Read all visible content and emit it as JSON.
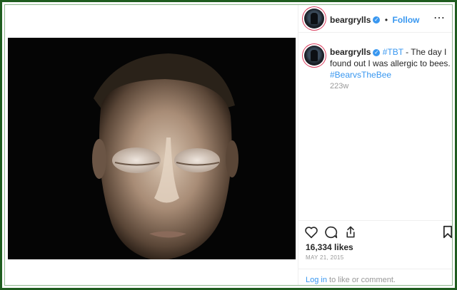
{
  "header": {
    "username": "beargrylls",
    "separator": "•",
    "follow_label": "Follow",
    "more_label": "⋯"
  },
  "post": {
    "username": "beargrylls",
    "hashtag_tbt": "#TBT",
    "caption_text": " - The day I found out I was allergic to bees.",
    "hashtag_bee": "#BearvsTheBee",
    "time_ago": "223w"
  },
  "stats": {
    "likes": "16,334 likes",
    "date": "MAY 21, 2015"
  },
  "login": {
    "link_label": "Log in",
    "suffix": " to like or comment."
  },
  "colors": {
    "frame_border": "#1e5c1e",
    "accent": "#3897f0"
  },
  "icons": [
    "heart-icon",
    "comment-icon",
    "share-icon",
    "bookmark-icon",
    "verified-badge-icon",
    "more-options-icon"
  ]
}
